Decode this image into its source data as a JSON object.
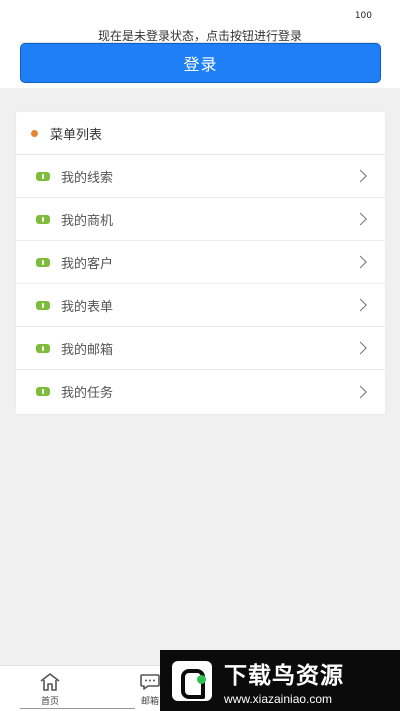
{
  "status_bar": {
    "value": "100"
  },
  "header": {
    "hint": "现在是未登录状态，点击按钮进行登录",
    "login_label": "登录",
    "login_color": "#1e7ff6"
  },
  "menu": {
    "title": "菜单列表",
    "dot_color": "#e3862f",
    "item_icon_color": "#7dbd3b",
    "items": [
      {
        "label": "我的线索"
      },
      {
        "label": "我的商机"
      },
      {
        "label": "我的客户"
      },
      {
        "label": "我的表单"
      },
      {
        "label": "我的邮箱"
      },
      {
        "label": "我的任务"
      }
    ]
  },
  "tabbar": {
    "tabs": [
      {
        "label": "首页",
        "icon": "home-icon"
      },
      {
        "label": "邮箱",
        "icon": "chat-icon"
      }
    ]
  },
  "watermark": {
    "title": "下载鸟资源",
    "url": "www.xiazainiao.com"
  }
}
